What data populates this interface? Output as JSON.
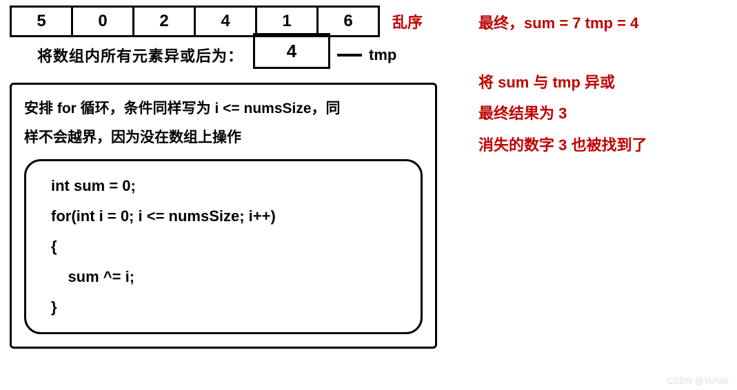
{
  "array": {
    "cells": [
      "5",
      "0",
      "2",
      "4",
      "1",
      "6"
    ],
    "label": "乱序"
  },
  "xor": {
    "text": "将数组内所有元素异或后为：",
    "result": "4",
    "tmp_label": "tmp"
  },
  "box": {
    "instruction_l1": "安排 for 循环，条件同样写为 i <= numsSize，同",
    "instruction_l2": "样不会越界，因为没在数组上操作",
    "code_l1": "int sum = 0;",
    "code_l2": "for(int i = 0; i <= numsSize; i++)",
    "code_l3": "{",
    "code_l4": "    sum ^= i;",
    "code_l5": "}"
  },
  "right": {
    "l1": "最终，sum = 7   tmp = 4",
    "l2": "将 sum 与 tmp 异或",
    "l3": "最终结果为 3",
    "l4": "消失的数字 3 也被找到了"
  },
  "watermark": "CSDN @Yohifo"
}
